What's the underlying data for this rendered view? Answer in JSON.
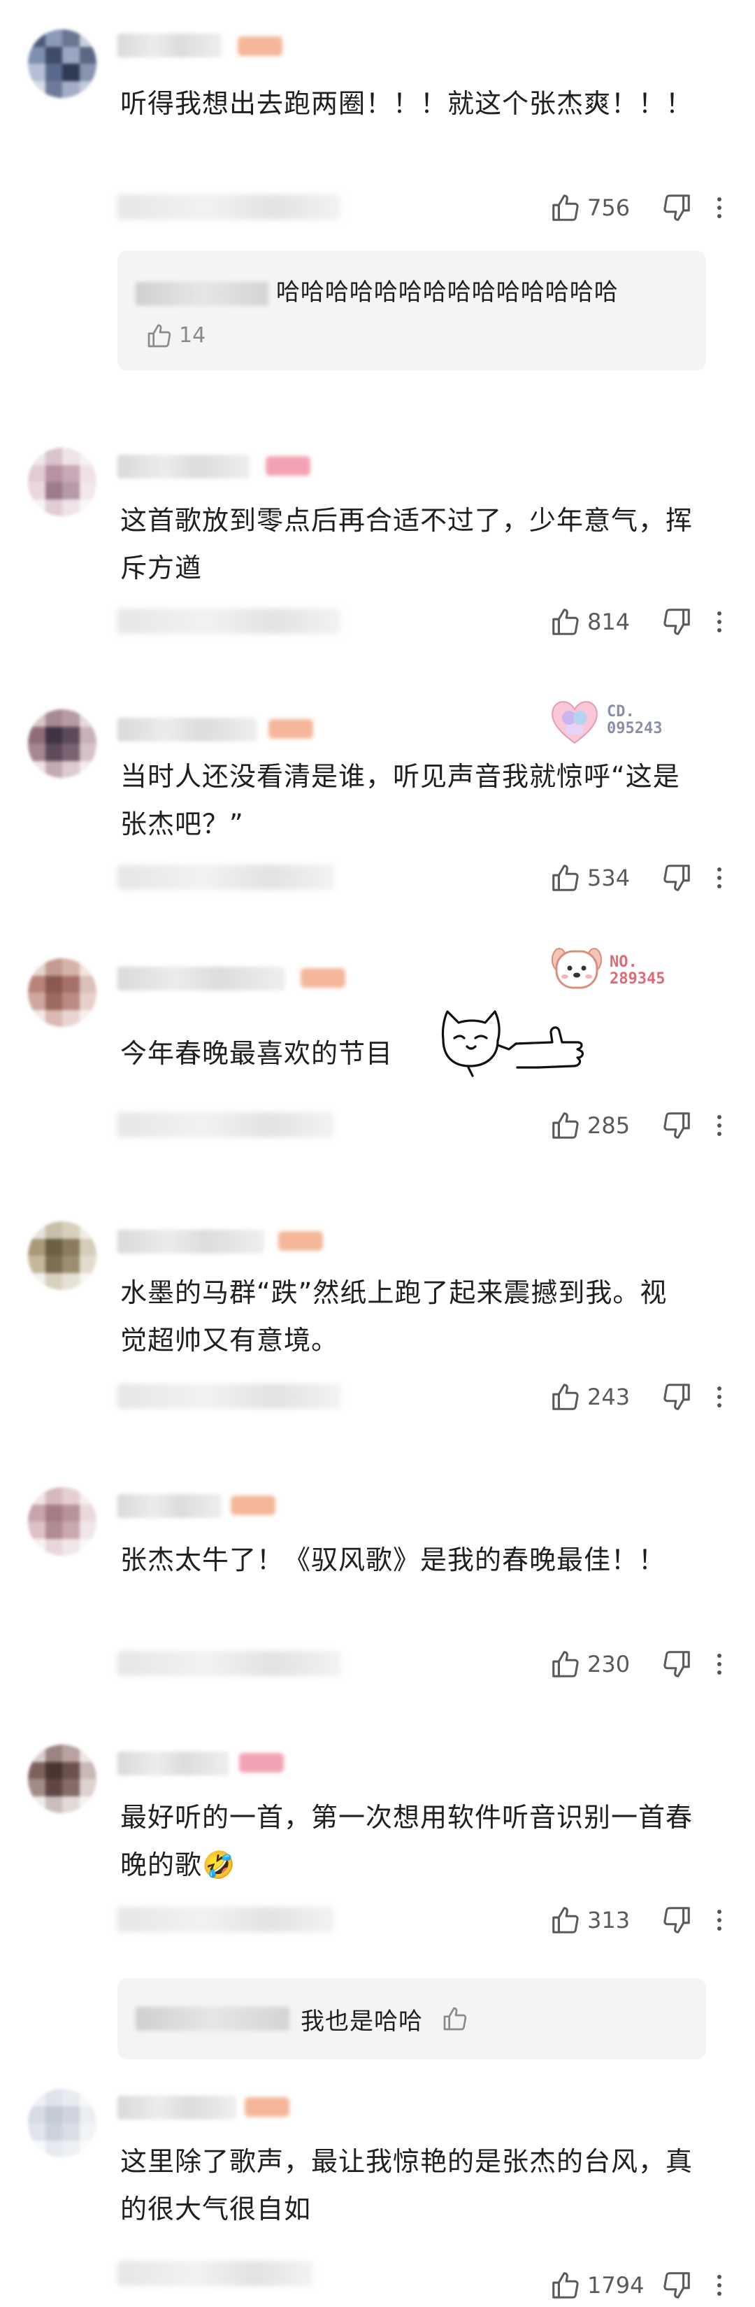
{
  "colors": {
    "fan_badge_pink": "#f2a2b4",
    "fan_badge_orange": "#f5b69a",
    "icon_grey": "#5a5a5a",
    "reply_bg": "#f4f4f5"
  },
  "comments": [
    {
      "text": "听得我想出去跑两圈！！！就这个张杰爽！！！",
      "likes": "756",
      "reply": {
        "text": "哈哈哈哈哈哈哈哈哈哈哈哈哈哈",
        "likes": "14"
      }
    },
    {
      "text": "这首歌放到零点后再合适不过了，少年意气，挥斥方遒",
      "likes": "814"
    },
    {
      "text": "当时人还没看清是谁，听见声音我就惊呼“这是张杰吧？”",
      "likes": "534",
      "sticker": {
        "line1": "CD.",
        "line2": "095243"
      }
    },
    {
      "text": "今年春晚最喜欢的节目",
      "likes": "285",
      "sticker": {
        "line1": "NO.",
        "line2": "289345"
      }
    },
    {
      "text": "水墨的马群“跌”然纸上跑了起来震撼到我。视觉超帅又有意境。",
      "likes": "243"
    },
    {
      "text": "张杰太牛了！《驭风歌》是我的春晚最佳！！",
      "likes": "230"
    },
    {
      "text": "最好听的一首，第一次想用软件听音识别一首春晚的歌🤣",
      "likes": "313",
      "reply": {
        "text": "我也是哈哈"
      }
    },
    {
      "text": "这里除了歌声，最让我惊艳的是张杰的台风，真的很大气很自如",
      "likes": "1794"
    }
  ]
}
